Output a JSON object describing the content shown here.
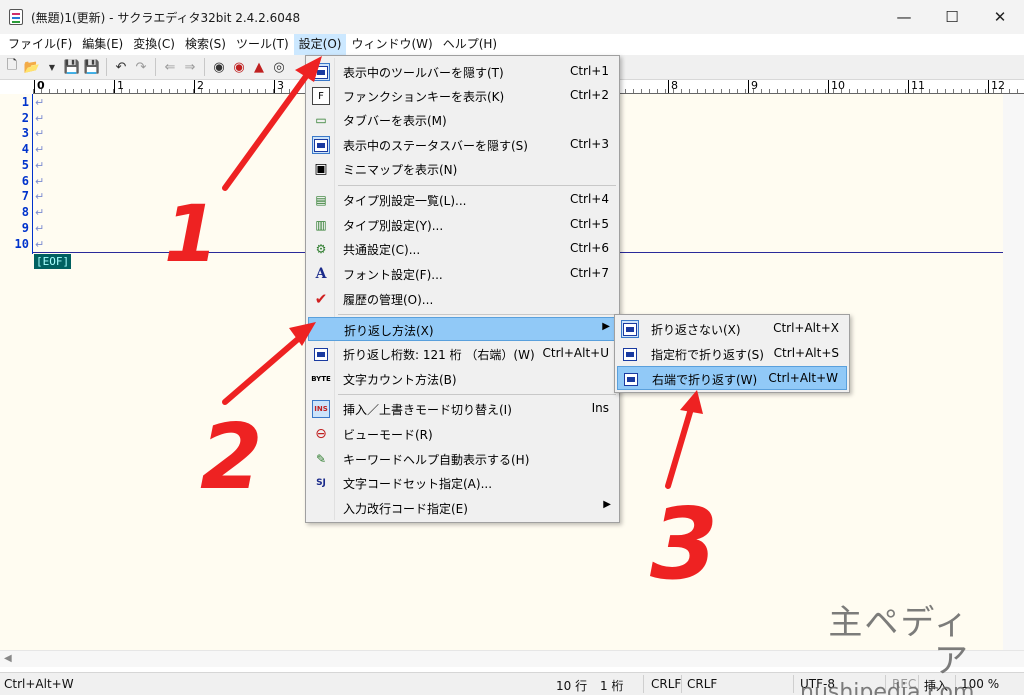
{
  "window": {
    "title": "(無題)1(更新) - サクラエディタ32bit 2.4.2.6048",
    "minimize": "—",
    "maximize": "☐",
    "close": "✕"
  },
  "menubar": [
    {
      "label": "ファイル(F)"
    },
    {
      "label": "編集(E)"
    },
    {
      "label": "変換(C)"
    },
    {
      "label": "検索(S)"
    },
    {
      "label": "ツール(T)"
    },
    {
      "label": "設定(O)"
    },
    {
      "label": "ウィンドウ(W)"
    },
    {
      "label": "ヘルプ(H)"
    }
  ],
  "toolbar": {
    "icons": [
      "new-file-icon",
      "open-file-icon",
      "dropdown-icon",
      "save-icon",
      "save-all-icon",
      "undo-icon",
      "redo-icon",
      "jump-back-icon",
      "jump-forward-icon",
      "search-prev-icon",
      "search-next-icon",
      "grep-icon",
      "compare-icon"
    ]
  },
  "ruler": {
    "labels": [
      "0",
      "1",
      "2",
      "3",
      "8",
      "9",
      "10",
      "11",
      "12"
    ]
  },
  "editor": {
    "line_numbers": [
      "1",
      "2",
      "3",
      "4",
      "5",
      "6",
      "7",
      "8",
      "9",
      "10"
    ],
    "eol_mark": "↵",
    "eof_label": "[EOF]"
  },
  "settings_menu": {
    "items": [
      {
        "label": "表示中のツールバーを隠す(T)",
        "shortcut": "Ctrl+1",
        "icon": "toolbar-icon"
      },
      {
        "label": "ファンクションキーを表示(K)",
        "shortcut": "Ctrl+2",
        "icon": "function-key-icon"
      },
      {
        "label": "タブバーを表示(M)",
        "shortcut": "",
        "icon": "tabbar-icon"
      },
      {
        "label": "表示中のステータスバーを隠す(S)",
        "shortcut": "Ctrl+3",
        "icon": "statusbar-icon"
      },
      {
        "label": "ミニマップを表示(N)",
        "shortcut": "",
        "icon": "minimap-icon"
      },
      {
        "label": "タイプ別設定一覧(L)...",
        "shortcut": "Ctrl+4",
        "icon": "type-list-icon"
      },
      {
        "label": "タイプ別設定(Y)...",
        "shortcut": "Ctrl+5",
        "icon": "type-settings-icon"
      },
      {
        "label": "共通設定(C)...",
        "shortcut": "Ctrl+6",
        "icon": "common-settings-icon"
      },
      {
        "label": "フォント設定(F)...",
        "shortcut": "Ctrl+7",
        "icon": "font-icon"
      },
      {
        "label": "履歴の管理(O)...",
        "shortcut": "",
        "icon": "history-icon"
      },
      {
        "label": "折り返し方法(X)",
        "shortcut": "",
        "icon": "",
        "submenu": true
      },
      {
        "label": "折り返し桁数: 121 桁 （右端）(W)",
        "shortcut": "Ctrl+Alt+U",
        "icon": "wrap-column-icon"
      },
      {
        "label": "文字カウント方法(B)",
        "shortcut": "",
        "icon": "byte-count-icon",
        "icon_text": "BYTE"
      },
      {
        "label": "挿入／上書きモード切り替え(I)",
        "shortcut": "Ins",
        "icon": "insert-mode-icon",
        "icon_text": "INS"
      },
      {
        "label": "ビューモード(R)",
        "shortcut": "",
        "icon": "view-mode-icon"
      },
      {
        "label": "キーワードヘルプ自動表示する(H)",
        "shortcut": "",
        "icon": "keyword-help-icon"
      },
      {
        "label": "文字コードセット指定(A)...",
        "shortcut": "",
        "icon": "charset-icon",
        "icon_text": "SJ"
      },
      {
        "label": "入力改行コード指定(E)",
        "shortcut": "",
        "icon": "",
        "submenu": true
      }
    ]
  },
  "wrap_submenu": {
    "items": [
      {
        "label": "折り返さない(X)",
        "shortcut": "Ctrl+Alt+X"
      },
      {
        "label": "指定桁で折り返す(S)",
        "shortcut": "Ctrl+Alt+S"
      },
      {
        "label": "右端で折り返す(W)",
        "shortcut": "Ctrl+Alt+W"
      }
    ]
  },
  "statusbar": {
    "message": "Ctrl+Alt+W",
    "line": "10 行",
    "column": "1 桁",
    "eol_1": "CRLF",
    "eol_2": "CRLF",
    "encoding": "UTF-8",
    "rec": "REC",
    "mode": "挿入",
    "zoom": "100 %"
  },
  "annotations": {
    "step1": "1",
    "step2": "2",
    "step3": "3",
    "color": "#ee2222"
  },
  "watermark": {
    "line1": "主ペディア",
    "line2": "nushipedia.com"
  }
}
